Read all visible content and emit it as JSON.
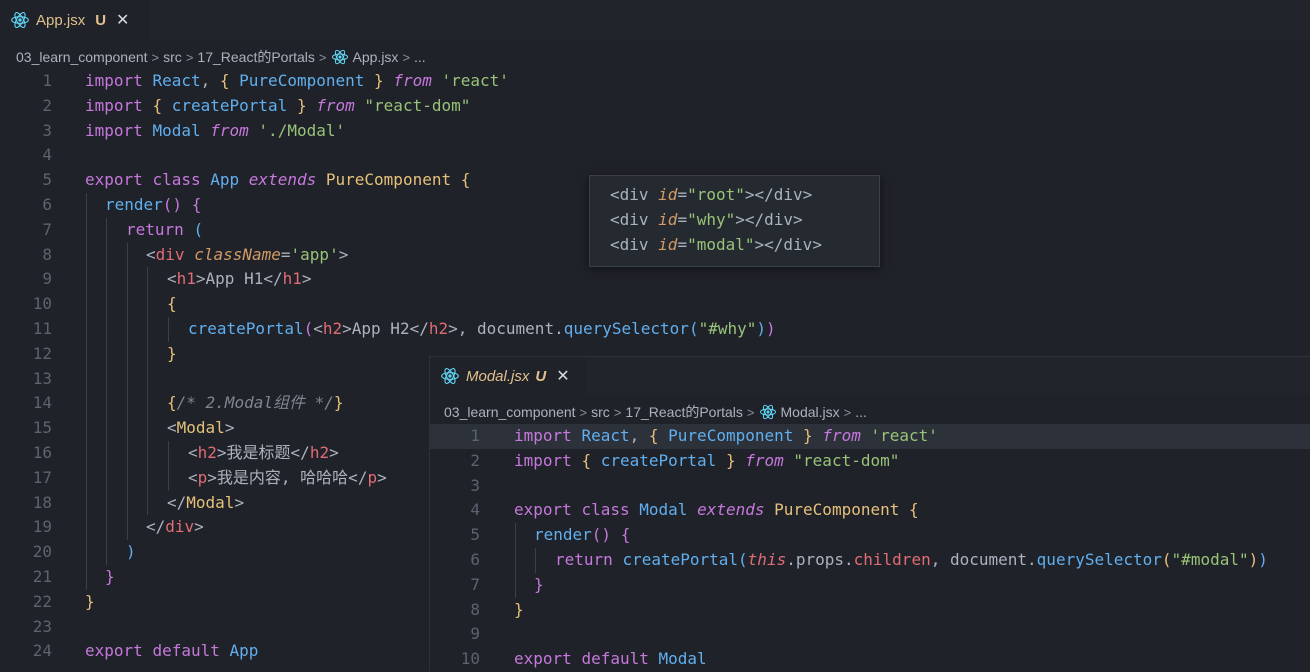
{
  "editor1": {
    "tab": {
      "filename": "App.jsx",
      "badge": "U",
      "close": "✕"
    },
    "breadcrumb": [
      "03_learn_component",
      "src",
      "17_React的Portals",
      "App.jsx",
      "..."
    ],
    "line_numbers": [
      "1",
      "2",
      "3",
      "4",
      "5",
      "6",
      "7",
      "8",
      "9",
      "10",
      "11",
      "12",
      "13",
      "14",
      "15",
      "16",
      "17",
      "18",
      "19",
      "20",
      "21",
      "22",
      "23",
      "24"
    ]
  },
  "popup": {
    "lines": [
      {
        "open": "<div ",
        "attr": "id",
        "val": "\"root\"",
        "close": "></div>"
      },
      {
        "open": "<div ",
        "attr": "id",
        "val": "\"why\"",
        "close": "></div>"
      },
      {
        "open": "<div ",
        "attr": "id",
        "val": "\"modal\"",
        "close": "></div>"
      }
    ]
  },
  "editor2": {
    "tab": {
      "filename": "Modal.jsx",
      "badge": "U",
      "close": "✕"
    },
    "breadcrumb": [
      "03_learn_component",
      "src",
      "17_React的Portals",
      "Modal.jsx",
      "..."
    ],
    "line_numbers": [
      "1",
      "2",
      "3",
      "4",
      "5",
      "6",
      "7",
      "8",
      "9",
      "10"
    ]
  },
  "colors": {
    "background": "#1f2228",
    "keyword": "#c678dd",
    "string": "#98c379",
    "tag": "#e06c75",
    "function": "#61afef",
    "bracket": "#e5c07b"
  }
}
